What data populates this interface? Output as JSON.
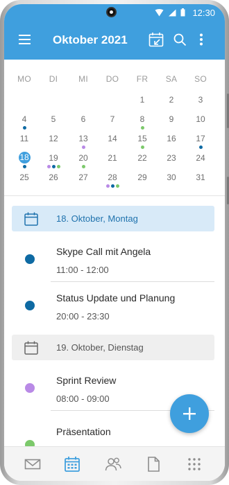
{
  "status_bar": {
    "time": "12:30"
  },
  "header": {
    "title": "Oktober 2021"
  },
  "calendar": {
    "weekdays": [
      "MO",
      "DI",
      "MI",
      "DO",
      "FR",
      "SA",
      "SO"
    ],
    "weeks": [
      [
        "",
        "",
        "",
        "",
        "1",
        "2",
        "3"
      ],
      [
        "4",
        "5",
        "6",
        "7",
        "8",
        "9",
        "10"
      ],
      [
        "11",
        "12",
        "13",
        "14",
        "15",
        "16",
        "17"
      ],
      [
        "18",
        "19",
        "20",
        "21",
        "22",
        "23",
        "24"
      ],
      [
        "25",
        "26",
        "27",
        "28",
        "29",
        "30",
        "31"
      ]
    ],
    "selected_day": "18",
    "event_dots": {
      "4": [
        "#0e6aa3"
      ],
      "8": [
        "#7cc96b"
      ],
      "13": [
        "#b98ae6"
      ],
      "15": [
        "#7cc96b"
      ],
      "17": [
        "#0e6aa3"
      ],
      "18": [
        "#0e6aa3"
      ],
      "19": [
        "#b98ae6",
        "#0e6aa3",
        "#7cc96b"
      ],
      "20": [
        "#7cc96b"
      ],
      "28": [
        "#b98ae6",
        "#0e6aa3",
        "#7cc96b"
      ]
    }
  },
  "agenda": {
    "days": [
      {
        "label": "18. Oktober, Montag",
        "selected": true,
        "events": [
          {
            "title": "Skype Call mit Angela",
            "time": "11:00 - 12:00",
            "color": "#0e6aa3"
          },
          {
            "title": "Status Update und Planung",
            "time": "20:00 - 23:30",
            "color": "#0e6aa3"
          }
        ]
      },
      {
        "label": "19. Oktober, Dienstag",
        "selected": false,
        "events": [
          {
            "title": "Sprint Review",
            "time": "08:00 - 09:00",
            "color": "#b98ae6"
          },
          {
            "title": "Präsentation",
            "time": "",
            "color": "#7cc96b"
          }
        ]
      }
    ]
  },
  "bottom_nav": {
    "items": [
      {
        "icon": "mail-icon",
        "active": false
      },
      {
        "icon": "calendar-icon",
        "active": true
      },
      {
        "icon": "people-icon",
        "active": false
      },
      {
        "icon": "file-icon",
        "active": false
      },
      {
        "icon": "apps-grid-icon",
        "active": false
      }
    ]
  },
  "colors": {
    "accent": "#3f9fde",
    "event_blue": "#0e6aa3",
    "event_purple": "#b98ae6",
    "event_green": "#7cc96b"
  }
}
